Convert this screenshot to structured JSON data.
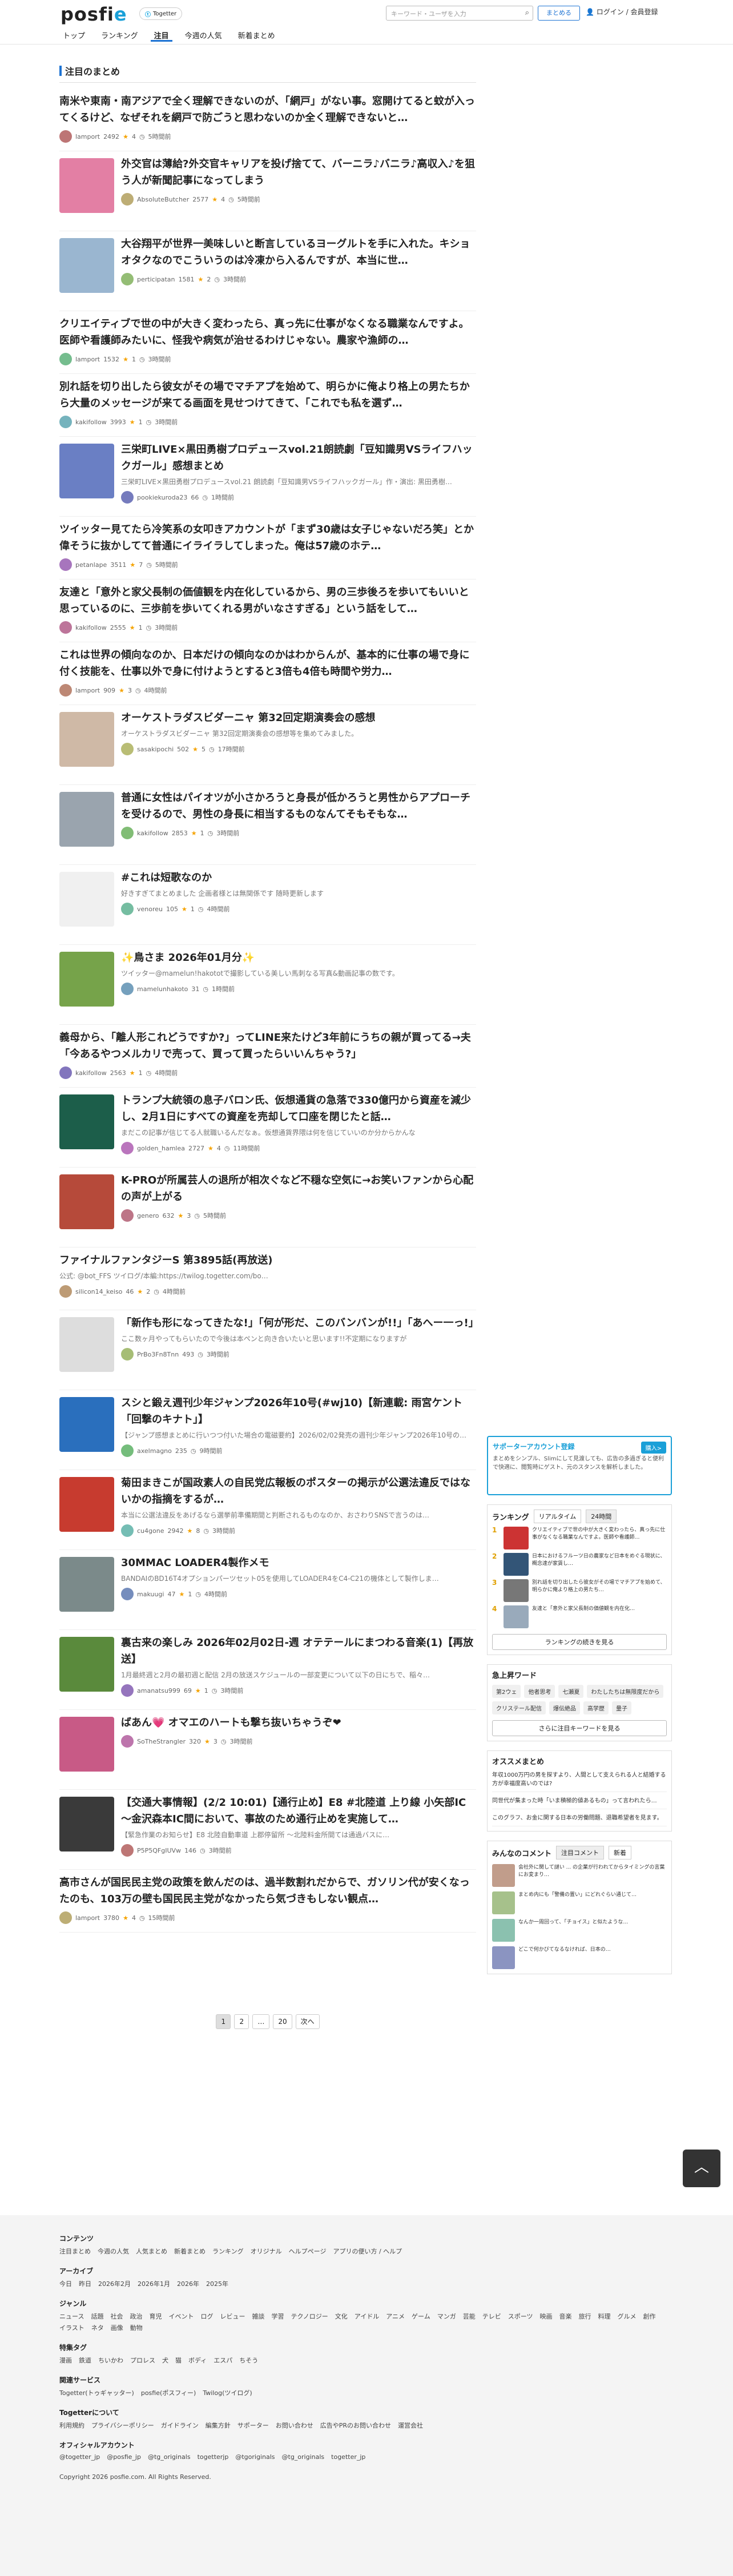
{
  "header": {
    "logo_pre": "posfi",
    "logo_post": "e",
    "tg_pill_label": "Togetter",
    "tg_pill_icon": "togetter-icon",
    "nav": [
      "トップ",
      "ランキング",
      "注目",
      "今週の人気",
      "新着まとめ"
    ],
    "search_placeholder": "キーワード・ユーザを入力",
    "create_label": "まとめる",
    "login_label": "ログイン / 会員登録"
  },
  "main": {
    "section_title": "注目のまとめ",
    "items": [
      {
        "title": "南米や東南・南アジアで全く理解できないのが、「網戸」がない事。窓開けてると蚊が入ってくるけど、なぜそれを網戸で防ごうと思わないのか全く理解できないと…",
        "desc": "",
        "user": "lamport",
        "views": "2492",
        "favs": "4",
        "ago": "5時間前",
        "thumb": null
      },
      {
        "title": "外交官は薄給?外交官キャリアを投げ捨てて、バーニラ♪バニラ♪高収入♪を狙う人が新聞記事になってしまう",
        "desc": "",
        "user": "AbsoluteButcher",
        "views": "2577",
        "favs": "4",
        "ago": "5時間前",
        "thumb": "#e37fa4"
      },
      {
        "title": "大谷翔平が世界一美味しいと断言しているヨーグルトを手に入れた。キショオタクなのでこういうのは冷凍から入るんですが、本当に世…",
        "desc": "",
        "user": "perticipatan",
        "views": "1581",
        "favs": "2",
        "ago": "3時間前",
        "thumb": "#9ab6d0"
      },
      {
        "title": "クリエイティブで世の中が大きく変わったら、真っ先に仕事がなくなる職業なんですよ。医師や看護師みたいに、怪我や病気が治せるわけじゃない。農家や漁師の…",
        "desc": "",
        "user": "lamport",
        "views": "1532",
        "favs": "1",
        "ago": "3時間前",
        "thumb": null
      },
      {
        "title": "別れ話を切り出したら彼女がその場でマチアプを始めて、明らかに俺より格上の男たちから大量のメッセージが来てる画面を見せつけてきて、「これでも私を選ず…",
        "desc": "",
        "user": "kakifollow",
        "views": "3993",
        "favs": "1",
        "ago": "3時間前",
        "thumb": null
      },
      {
        "title": "三栄町LIVE×黒田勇樹プロデュースvol.21朗読劇「豆知識男VSライフハックガール」感想まとめ",
        "desc": "三栄町LIVE×黒田勇樹プロデュースvol.21 朗読劇「豆知識男VSライフハックガール」作・演出: 黒田勇樹…",
        "user": "pookiekuroda23",
        "views": "66",
        "favs": "",
        "ago": "1時間前",
        "thumb": "#6a7fc4"
      },
      {
        "title": "ツイッター見てたら冷笑系の女叩きアカウントが「まず30歳は女子じゃないだろ笑」とか偉そうに抜かしてて普通にイライラしてしまった。俺は57歳のホテ…",
        "desc": "",
        "user": "petanlape",
        "views": "3511",
        "favs": "7",
        "ago": "5時間前",
        "thumb": null
      },
      {
        "title": "友達と「意外と家父長制の価値観を内在化しているから、男の三歩後ろを歩いてもいいと思っているのに、三歩前を歩いてくれる男がいなさすぎる」という話をして…",
        "desc": "",
        "user": "kakifollow",
        "views": "2555",
        "favs": "1",
        "ago": "3時間前",
        "thumb": null
      },
      {
        "title": "これは世界の傾向なのか、日本だけの傾向なのかはわからんが、基本的に仕事の場で身に付く技能を、仕事以外で身に付けようとすると3倍も4倍も時間や労力…",
        "desc": "",
        "user": "lamport",
        "views": "909",
        "favs": "3",
        "ago": "4時間前",
        "thumb": null
      },
      {
        "title": "オーケストラダスビダーニャ 第32回定期演奏会の感想",
        "desc": "オーケストラダスビダーニャ 第32回定期演奏会の感想等を集めてみました。",
        "user": "sasakipochi",
        "views": "502",
        "favs": "5",
        "ago": "17時間前",
        "thumb": "#cfb9a6"
      },
      {
        "title": "普通に女性はパイオツが小さかろうと身長が低かろうと男性からアプローチを受けるので、男性の身長に相当するものなんてそもそもな…",
        "desc": "",
        "user": "kakifollow",
        "views": "2853",
        "favs": "1",
        "ago": "3時間前",
        "thumb": "#9aa4ae"
      },
      {
        "title": "#これは短歌なのか",
        "desc": "好きすぎてまとめました 企画者様とは無関係です 随時更新します",
        "user": "venoreu",
        "views": "105",
        "favs": "1",
        "ago": "4時間前",
        "thumb": "#f0f0f0"
      },
      {
        "title": "✨鳥さま 2026年01月分✨",
        "desc": "ツイッター@mamelun!hakototで撮影している美しい馬刺なる写真&動画記事の数です。",
        "user": "mamelunhakoto",
        "views": "31",
        "favs": "",
        "ago": "1時間前",
        "thumb": "#76a34a"
      },
      {
        "title": "義母から、「離人形これどうですか?」ってLINE来たけど3年前にうちの親が買ってる→夫「今あるやつメルカリで売って、買って買ったらいいんちゃう?」",
        "desc": "",
        "user": "kakifollow",
        "views": "2563",
        "favs": "1",
        "ago": "4時間前",
        "thumb": null
      },
      {
        "title": "トランプ大統領の息子バロン氏、仮想通貨の急落で330億円から資産を減少し、2月1日にすべての資産を売却して口座を閉じたと話…",
        "desc": "まだこの記事が信じてる人就職いるんだなぁ。仮想通貨界隈は何を信じていいのか分からかんな",
        "user": "golden_hamlea",
        "views": "2727",
        "favs": "4",
        "ago": "11時間前",
        "thumb": "#1c5e4a"
      },
      {
        "title": "K-PROが所属芸人の退所が相次ぐなど不穏な空気に→お笑いファンから心配の声が上がる",
        "desc": "",
        "user": "genero",
        "views": "632",
        "favs": "3",
        "ago": "5時間前",
        "thumb": "#b64a3a"
      },
      {
        "title": "ファイナルファンタジーS 第3895話(再放送)",
        "desc": "公式: @bot_FFS ツイログ/本編:https://twilog.togetter.com/bo…",
        "user": "silicon14_keiso",
        "views": "46",
        "favs": "2",
        "ago": "4時間前",
        "thumb": null
      },
      {
        "title": "「新作も形になってきたな!」「何が形だ、このバンバンが!!」「あへー一っ!」",
        "desc": "ここ数ヶ月やってもらいたので今後は本ペンと向き合いたいと思います!!不定期になりますが",
        "user": "PrBo3Fn8Tnn",
        "views": "493",
        "favs": "",
        "ago": "3時間前",
        "thumb": "#ddd"
      },
      {
        "title": "スシと鍛え週刊少年ジャンプ2026年10号(#wj10)【新連載: 雨宮ケント「回撃のキナト」】",
        "desc": "【ジャンプ感想まとめに行いつつ付いた場合の電磁要約】2026/02/02発売の週刊少年ジャンプ2026年10号の…",
        "user": "axelmagno",
        "views": "235",
        "favs": "",
        "ago": "9時間前",
        "thumb": "#2a6fbd"
      },
      {
        "title": "菊田まきこが国政素人の自民党広報板のポスターの掲示が公選法違反ではないかの指摘をするが…",
        "desc": "本当に公選法違反をあげるなら選挙前準備期間と判断されるものなのか、おさわりSNSで言うのは…",
        "user": "cu4gone",
        "views": "2942",
        "favs": "8",
        "ago": "3時間前",
        "thumb": "#c73b2f"
      },
      {
        "title": "30MMAC LOADER4製作メモ",
        "desc": "BANDAIのBD16T4オプションパーツセット05を使用してLOADER4をC4-C21の機体として製作しま…",
        "user": "makuugi",
        "views": "47",
        "favs": "1",
        "ago": "4時間前",
        "thumb": "#7b8a8a"
      },
      {
        "title": "裏古来の楽しみ 2026年02月02日-週 オテテールにまつわる音楽(1)【再放送】",
        "desc": "1月最終週と2月の最初週と配信 2月の放送スケジュールの一部変更について以下の日にちで、稲々…",
        "user": "amanatsu999",
        "views": "69",
        "favs": "1",
        "ago": "3時間前",
        "thumb": "#5a8a3c"
      },
      {
        "title": "ばあん💗 オマエのハートも撃ち抜いちゃうぞ❤",
        "desc": "",
        "user": "SoTheStrangler",
        "views": "320",
        "favs": "3",
        "ago": "3時間前",
        "thumb": "#c85a86"
      },
      {
        "title": "【交通大事情報】(2/2 10:01)【通行止め】E8 #北陸道 上り線 小矢部IC～金沢森本IC間において、事故のため通行止めを実施して…",
        "desc": "【緊急作業のお知らせ】E8 北陸自動車道 上郡停留所 ～北陸料金所間ては通過バスに…",
        "user": "P5P5QFgIUVw",
        "views": "146",
        "favs": "",
        "ago": "3時間前",
        "thumb": "#3a3a3a"
      },
      {
        "title": "高市さんが国民民主党の政策を飲んだのは、過半数割れだからで、ガソリン代が安くなったのも、103万の壁も国民民主党がなかったら気づきもしない観点…",
        "desc": "",
        "user": "lamport",
        "views": "3780",
        "favs": "4",
        "ago": "15時間前",
        "thumb": null
      }
    ]
  },
  "pager": {
    "pages": [
      "1",
      "2",
      "…",
      "20"
    ],
    "next": "次へ"
  },
  "side": {
    "support": {
      "head": "サポーターアカウント登録",
      "badge": "購入>",
      "text": "まとめをシンプル、Slimにして見渡しても、広告の多過ぎると便利で快適に、閲覧時にゲスト、元のスタンスを解析しました。"
    },
    "ranking": {
      "head": "ランキング",
      "tabs": [
        "リアルタイム",
        "24時間"
      ],
      "items": [
        {
          "num": "1",
          "text": "クリエイティブで世の中が大きく変わったら、真っ先に仕事がなくなる職業なんですよ。医師や看護師…",
          "thumb": "#c33"
        },
        {
          "num": "2",
          "text": "日本におけるフルーツ日の農家など日本をめぐる現状に、概念達が家賃し…",
          "thumb": "#357"
        },
        {
          "num": "3",
          "text": "別れ話を切り出したら彼女がその場でマチアプを始めて、明らかに俺より格上の男たち…",
          "thumb": "#777"
        },
        {
          "num": "4",
          "text": "友達と「意外と家父長制の価値観を内在化…",
          "thumb": "#9ab"
        }
      ],
      "more": "ランキングの続きを見る"
    },
    "keywords": {
      "head": "急上昇ワード",
      "items": [
        "第2ウェ",
        "他者思考",
        "七瀬夏",
        "わたしたちは無限度だから",
        "クリステール配信",
        "爆伝絶品",
        "高学歴",
        "量子"
      ],
      "more": "さらに注目キーワードを見る"
    },
    "recommend": {
      "head": "オススメまとめ",
      "items": [
        "年収1000万円の男を探すより、人間として支えられる人と結婚する方が幸福度高いのでは?",
        "同世代が集まった時「いま積極的値あるもの」って言われたら…",
        "このグラフ、お金に関する日本の労働問題、退職希望者を見ます。"
      ]
    },
    "tweets": {
      "head": "みんなのコメント",
      "tabs": [
        "注目コメント",
        "新着"
      ],
      "items": [
        "会社外に関して謎い ... の企業が行われてからタイミングの言葉にお変まり…",
        "まとめ内にも「警備の置い」にどれぐらい通じて…",
        "なんか一周回って、「チョイス」と似たような…",
        "どこで何かびてなるなければ、日本の…"
      ]
    }
  },
  "footer": {
    "sections": [
      {
        "h": "コンテンツ",
        "l": [
          "注目まとめ",
          "今週の人気",
          "人気まとめ",
          "新着まとめ",
          "ランキング",
          "オリジナル",
          "ヘルプページ",
          "アプリの便い方 / ヘルプ"
        ]
      },
      {
        "h": "アーカイブ",
        "l": [
          "今日",
          "昨日",
          "2026年2月",
          "2026年1月",
          "2026年",
          "2025年"
        ]
      },
      {
        "h": "ジャンル",
        "l": [
          "ニュース",
          "話題",
          "社会",
          "政治",
          "育児",
          "イベント",
          "ログ",
          "レビュー",
          "雑談",
          "学習",
          "テクノロジー",
          "文化",
          "アイドル",
          "アニメ",
          "ゲーム",
          "マンガ",
          "芸能",
          "テレビ",
          "スポーツ",
          "映画",
          "音楽",
          "旅行",
          "料理",
          "グルメ",
          "創作",
          "イラスト",
          "ネタ",
          "画像",
          "動物"
        ]
      },
      {
        "h": "特集タグ",
        "l": [
          "漫画",
          "鉄道",
          "ちいかわ",
          "プロレス",
          "犬",
          "猫",
          "ボディ",
          "エスパ",
          "ちそう"
        ]
      },
      {
        "h": "関連サービス",
        "l": [
          "Togetter(トゥギャッター)",
          "posfie(ポスフィー)",
          "Twilog(ツイログ)"
        ]
      },
      {
        "h": "Togetterについて",
        "l": [
          "利用規約",
          "プライバシーポリシー",
          "ガイドライン",
          "編集方針",
          "サポーター",
          "お問い合わせ",
          "広告やPRのお問い合わせ",
          "運営会社"
        ]
      },
      {
        "h": "オフィシャルアカウント",
        "l": [
          "@togetter_jp",
          "@posfie_jp",
          "@tg_originals",
          "togetterjp",
          "@tgoriginals",
          "@tg_originals",
          "togetter_jp"
        ]
      }
    ],
    "copyright": "Copyright 2026 posfie.com. All Rights Reserved."
  }
}
